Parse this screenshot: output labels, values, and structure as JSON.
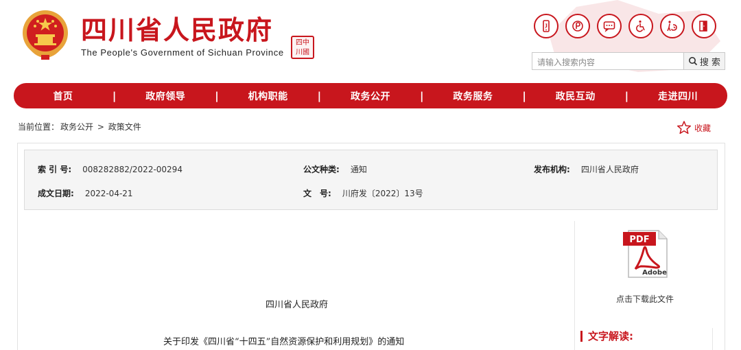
{
  "header": {
    "title": "四川省人民政府",
    "subtitle": "The People's Government of Sichuan Province",
    "seal_text": [
      "四中",
      "川國"
    ],
    "tool_icons": [
      "mobile-icon",
      "weibo-icon",
      "message-icon",
      "accessibility-icon",
      "elderly-care-icon",
      "exit-icon"
    ],
    "search_placeholder": "请输入搜索内容",
    "search_label": "搜 索"
  },
  "nav": {
    "items": [
      "首页",
      "政府领导",
      "机构职能",
      "政务公开",
      "政务服务",
      "政民互动",
      "走进四川"
    ],
    "separator": "|"
  },
  "breadcrumb": {
    "prefix": "当前位置：",
    "items": [
      "政务公开",
      "政策文件"
    ],
    "separator": ">"
  },
  "favorite": {
    "label": "收藏"
  },
  "meta": {
    "index_no_label": "索 引 号:",
    "index_no": "008282882/2022-00294",
    "doc_type_label": "公文种类:",
    "doc_type": "通知",
    "issuer_label": "发布机构:",
    "issuer": "四川省人民政府",
    "date_label": "成文日期:",
    "date": "2022-04-21",
    "doc_no_label": "文　号:",
    "doc_no": "川府发〔2022〕13号"
  },
  "document": {
    "issuer_line": "四川省人民政府",
    "title_line": "关于印发《四川省“十四五”自然资源保护和利用规划》的通知"
  },
  "sidebar": {
    "pdf_text": "PDF",
    "pdf_brand": "Adobe",
    "download_label": "点击下载此文件",
    "interpretation_label": "文字解读:"
  },
  "colors": {
    "brand_red": "#c8161d",
    "meta_bg": "#f5f5f5"
  }
}
